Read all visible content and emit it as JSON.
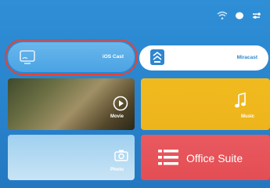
{
  "status_icons": [
    "wifi-icon",
    "bluetooth-icon",
    "settings-icon"
  ],
  "tiles": {
    "ios_cast": {
      "label": "iOS Cast",
      "icon": "cast-screen-icon",
      "selected": true
    },
    "miracast": {
      "label": "Miracast",
      "icon": "miracast-icon"
    },
    "movie": {
      "label": "Movie",
      "icon": "play-icon"
    },
    "music": {
      "label": "Music",
      "icon": "music-note-icon"
    },
    "photo": {
      "label": "Photo",
      "icon": "camera-icon"
    },
    "office": {
      "label": "Office Suite",
      "icon": "document-lines-icon"
    }
  },
  "colors": {
    "background": "#2a86cf",
    "selection_outline": "#e04438",
    "music_tile": "#eeb41c",
    "office_tile": "#e44d54",
    "miracast_text": "#2f86cf"
  }
}
